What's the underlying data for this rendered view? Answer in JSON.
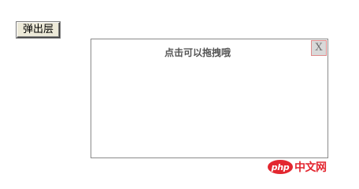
{
  "toolbar": {
    "open_button_label": "弹出层"
  },
  "dialog": {
    "drag_hint": "点击可以拖拽哦",
    "close_label": "X"
  },
  "watermark": {
    "logo_text": "php",
    "site_text": "中文网",
    "brand_color": "#e3262f"
  }
}
